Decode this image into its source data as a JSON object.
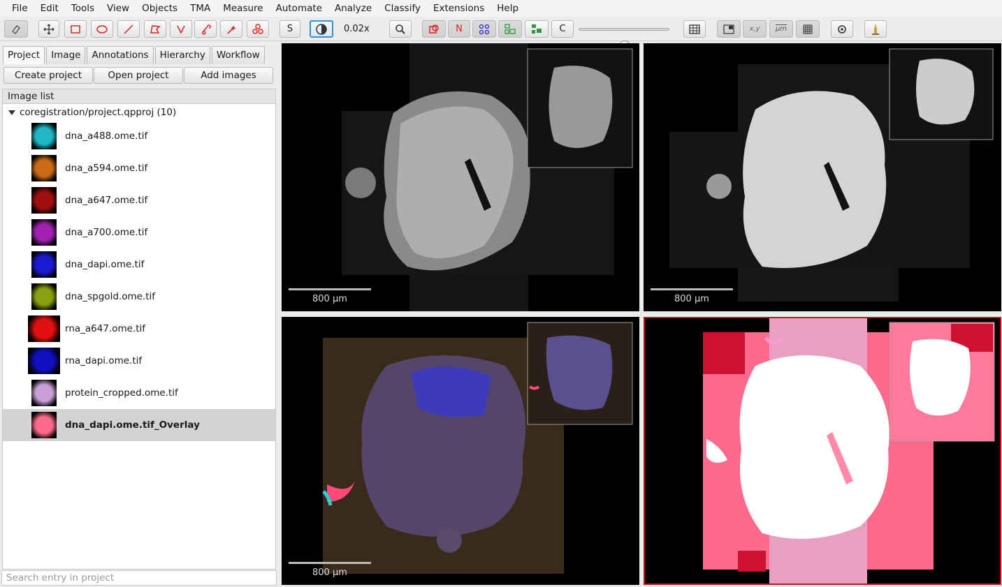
{
  "menu": [
    "File",
    "Edit",
    "Tools",
    "View",
    "Objects",
    "TMA",
    "Measure",
    "Automate",
    "Analyze",
    "Classify",
    "Extensions",
    "Help"
  ],
  "toolbar": {
    "zoom": "0.02x",
    "s_label": "S",
    "n_label": "N",
    "c_label": "C",
    "xy_label": "x,y",
    "um_label": "μm"
  },
  "tabs": [
    "Project",
    "Image",
    "Annotations",
    "Hierarchy",
    "Workflow"
  ],
  "project_buttons": [
    "Create project",
    "Open project",
    "Add images"
  ],
  "image_list": {
    "header": "Image list",
    "root": "coregistration/project.qpproj (10)",
    "entries": [
      {
        "name": "dna_a488.ome.tif",
        "color": "#1fb8c4"
      },
      {
        "name": "dna_a594.ome.tif",
        "color": "#c86a18"
      },
      {
        "name": "dna_a647.ome.tif",
        "color": "#a01010"
      },
      {
        "name": "dna_a700.ome.tif",
        "color": "#a020b0"
      },
      {
        "name": "dna_dapi.ome.tif",
        "color": "#1a1ad0"
      },
      {
        "name": "dna_spgold.ome.tif",
        "color": "#8aa010"
      },
      {
        "name": "rna_a647.ome.tif",
        "color": "#e01010"
      },
      {
        "name": "rna_dapi.ome.tif",
        "color": "#1010c0"
      },
      {
        "name": "protein_cropped.ome.tif",
        "color": "#c8a0d8"
      },
      {
        "name": "dna_dapi.ome.tif_Overlay",
        "color": "#ff6a8a"
      }
    ],
    "selected_index": 9
  },
  "search": {
    "placeholder": "Search entry in project"
  },
  "viewers": [
    {
      "scale_label": "800 µm"
    },
    {
      "scale_label": "800 µm"
    },
    {
      "scale_label": "800 µm"
    }
  ]
}
